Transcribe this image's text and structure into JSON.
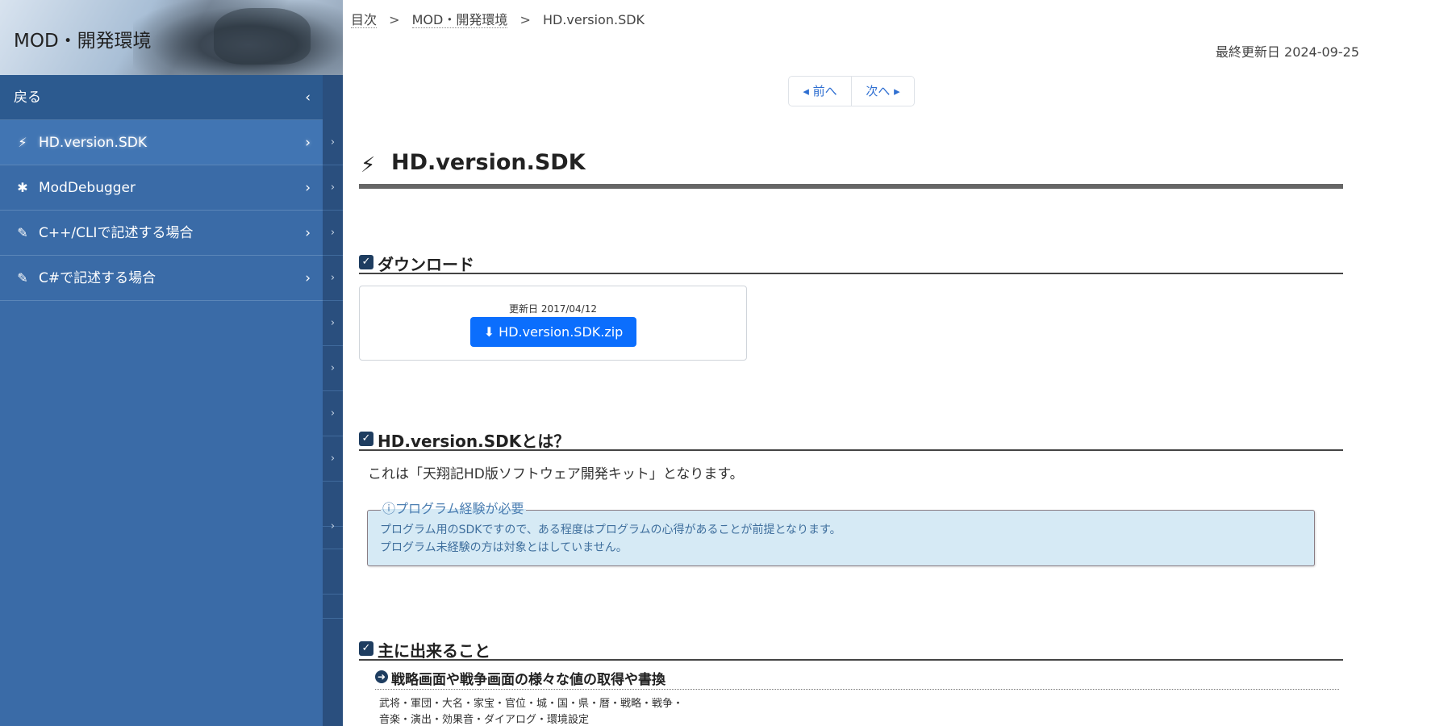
{
  "sidebar": {
    "title": "MOD・開発環境",
    "back_label": "戻る",
    "items": [
      {
        "label": "HD.version.SDK",
        "icon": "plug-icon"
      },
      {
        "label": "ModDebugger",
        "icon": "bug-icon"
      },
      {
        "label": "C++/CLIで記述する場合",
        "icon": "edit-icon"
      },
      {
        "label": "C#で記述する場合",
        "icon": "edit-icon"
      }
    ]
  },
  "breadcrumb": {
    "items": [
      "目次",
      "MOD・開発環境"
    ],
    "current": "HD.version.SDK",
    "separator": ">"
  },
  "last_updated": "最終更新日 2024-09-25",
  "pager": {
    "prev": "前へ",
    "next": "次へ"
  },
  "page_title": "HD.version.SDK",
  "sections": {
    "download": {
      "heading": "ダウンロード",
      "date": "更新日 2017/04/12",
      "button": "HD.version.SDK.zip"
    },
    "about": {
      "heading": "HD.version.SDKとは？",
      "text": "これは「天翔記HD版ソフトウェア開発キット」となります。",
      "notice_title": "プログラム経験が必要",
      "notice_lines": [
        "プログラム用のSDKですので、ある程度はプログラムの心得があることが前提となります。",
        "プログラム未経験の方は対象とはしていません。"
      ]
    },
    "features": {
      "heading": "主に出来ること",
      "subheading": "戦略画面や戦争画面の様々な値の取得や書換",
      "lines": [
        "武将・軍団・大名・家宝・官位・城・国・県・暦・戦略・戦争・",
        "音楽・演出・効果音・ダイアログ・環境設定"
      ]
    }
  },
  "colors": {
    "sidebar_bg": "#3a6ba7",
    "accent_button": "#0b6efd",
    "notice_bg": "#d6eaf5"
  }
}
